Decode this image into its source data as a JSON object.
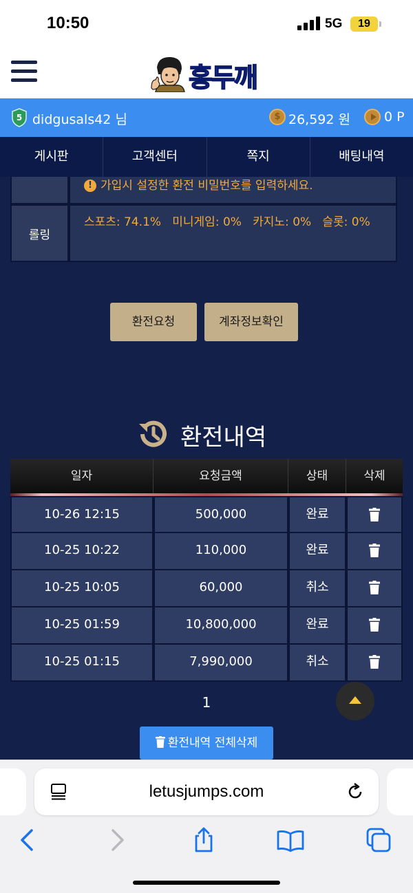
{
  "status": {
    "time": "10:50",
    "network": "5G",
    "battery": "19"
  },
  "header": {
    "logo_text": "홍두깨"
  },
  "user": {
    "name": "didgusals42 님",
    "money": "26,592 원",
    "points": "0 P"
  },
  "nav": [
    "게시판",
    "고객센터",
    "쪽지",
    "배팅내역"
  ],
  "info": {
    "password_hint": "가입시 설정한 환전 비밀번호를 입력하세요.",
    "rolling_label": "롤링",
    "rolling_value": "스포츠: 74.1%   미니게임: 0%   카지노: 0%   슬롯: 0%"
  },
  "buttons": {
    "exchange_request": "환전요청",
    "account_check": "계좌정보확인",
    "delete_all": "환전내역 전체삭제"
  },
  "history": {
    "title": "환전내역",
    "columns": [
      "일자",
      "요청금액",
      "상태",
      "삭제"
    ],
    "rows": [
      {
        "date": "10-26 12:15",
        "amount": "500,000",
        "status": "완료"
      },
      {
        "date": "10-25 10:22",
        "amount": "110,000",
        "status": "완료"
      },
      {
        "date": "10-25 10:05",
        "amount": "60,000",
        "status": "취소"
      },
      {
        "date": "10-25 01:59",
        "amount": "10,800,000",
        "status": "완료"
      },
      {
        "date": "10-25 01:15",
        "amount": "7,990,000",
        "status": "취소"
      }
    ],
    "page": "1"
  },
  "browser": {
    "url": "letusjumps.com"
  },
  "colors": {
    "accent_blue": "#3b8ef0",
    "navy": "#0c1a4a",
    "panel": "#13204a",
    "tan_button": "#c3b08a",
    "warning": "#f2a93b"
  }
}
